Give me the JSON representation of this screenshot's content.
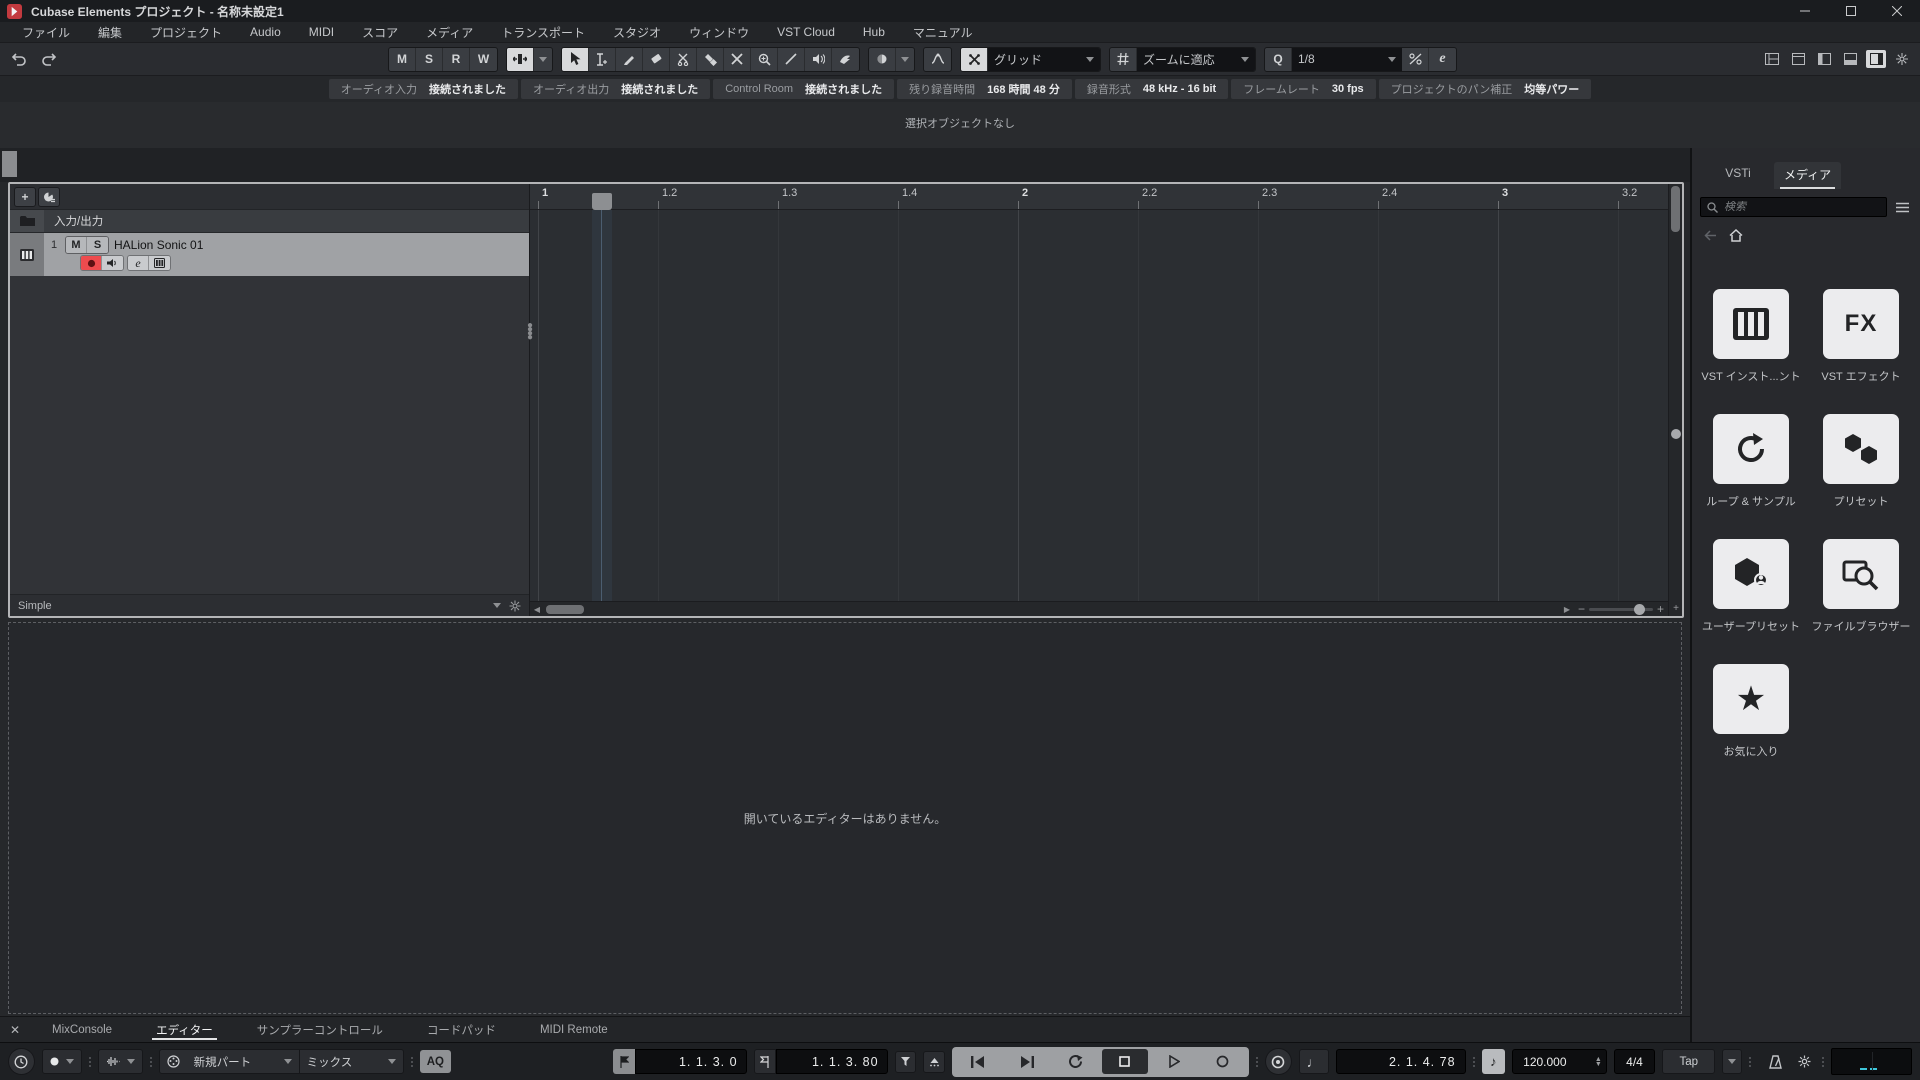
{
  "titlebar": {
    "title": "Cubase Elements プロジェクト - 名称未設定1"
  },
  "menubar": {
    "items": [
      "ファイル",
      "編集",
      "プロジェクト",
      "Audio",
      "MIDI",
      "スコア",
      "メディア",
      "トランスポート",
      "スタジオ",
      "ウィンドウ",
      "VST Cloud",
      "Hub",
      "マニュアル"
    ]
  },
  "toolbar": {
    "automation": {
      "mute": "M",
      "solo": "S",
      "read": "R",
      "write": "W"
    },
    "snap_type_value": "グリッド",
    "grid_type_value": "ズームに適応",
    "quantize_value": "1/8"
  },
  "status_bar": {
    "items": [
      {
        "label": "オーディオ入力",
        "value": "接続されました"
      },
      {
        "label": "オーディオ出力",
        "value": "接続されました"
      },
      {
        "label": "Control Room",
        "value": "接続されました"
      },
      {
        "label": "残り録音時間",
        "value": "168 時間 48 分"
      },
      {
        "label": "録音形式",
        "value": "48 kHz - 16 bit"
      },
      {
        "label": "フレームレート",
        "value": "30 fps"
      },
      {
        "label": "プロジェクトのパン補正",
        "value": "均等パワー"
      }
    ]
  },
  "info_line": {
    "text": "選択オブジェクトなし"
  },
  "track_panel": {
    "io_row_label": "入力/出力",
    "track": {
      "number": "1",
      "name": "HALion Sonic 01",
      "mute": "M",
      "solo": "S",
      "edit": "e"
    },
    "preset_label": "Simple"
  },
  "ruler": {
    "ticks": [
      {
        "label": "1"
      },
      {
        "label": "1.2"
      },
      {
        "label": "1.3"
      },
      {
        "label": "1.4"
      },
      {
        "label": "2"
      },
      {
        "label": "2.2"
      },
      {
        "label": "2.3"
      },
      {
        "label": "2.4"
      },
      {
        "label": "3"
      },
      {
        "label": "3.2"
      }
    ]
  },
  "lower_zone": {
    "empty_text": "開いているエディターはありません。"
  },
  "bottom_tabs": {
    "items": [
      "MixConsole",
      "エディター",
      "サンプラーコントロール",
      "コードパッド",
      "MIDI Remote"
    ],
    "active": "エディター"
  },
  "right_zone": {
    "tabs": [
      "VSTi",
      "メディア"
    ],
    "active_tab": "メディア",
    "search_placeholder": "検索",
    "tiles": [
      {
        "icon": "piano-icon",
        "label": "VST インスト...ント"
      },
      {
        "icon": "fx-icon",
        "label": "VST エフェクト",
        "icon_text": "FX"
      },
      {
        "icon": "loop-icon",
        "label": "ループ & サンプル"
      },
      {
        "icon": "hexagons-icon",
        "label": "プリセット"
      },
      {
        "icon": "user-preset-icon",
        "label": "ユーザープリセット"
      },
      {
        "icon": "file-browser-icon",
        "label": "ファイルブラウザー"
      },
      {
        "icon": "star-icon",
        "label": "お気に入り",
        "glyph": "★"
      }
    ]
  },
  "transport": {
    "midi_insert_mode": "新規パート",
    "midi_record_mode": "ミックス",
    "auto_quantize_label": "AQ",
    "left_locator": "1. 1. 3. 0",
    "right_locator": "1. 1. 3. 80",
    "position": "2. 1. 4. 78",
    "tempo": "120.000",
    "time_signature": "4/4",
    "tap_label": "Tap"
  },
  "colors": {
    "record_red": "#ee4b4e",
    "selected_track_gray": "#a0a2a5",
    "tile_bg": "#ececee",
    "meter_cyan": "#3fc6da",
    "frame_light": "#b4b5b7"
  }
}
